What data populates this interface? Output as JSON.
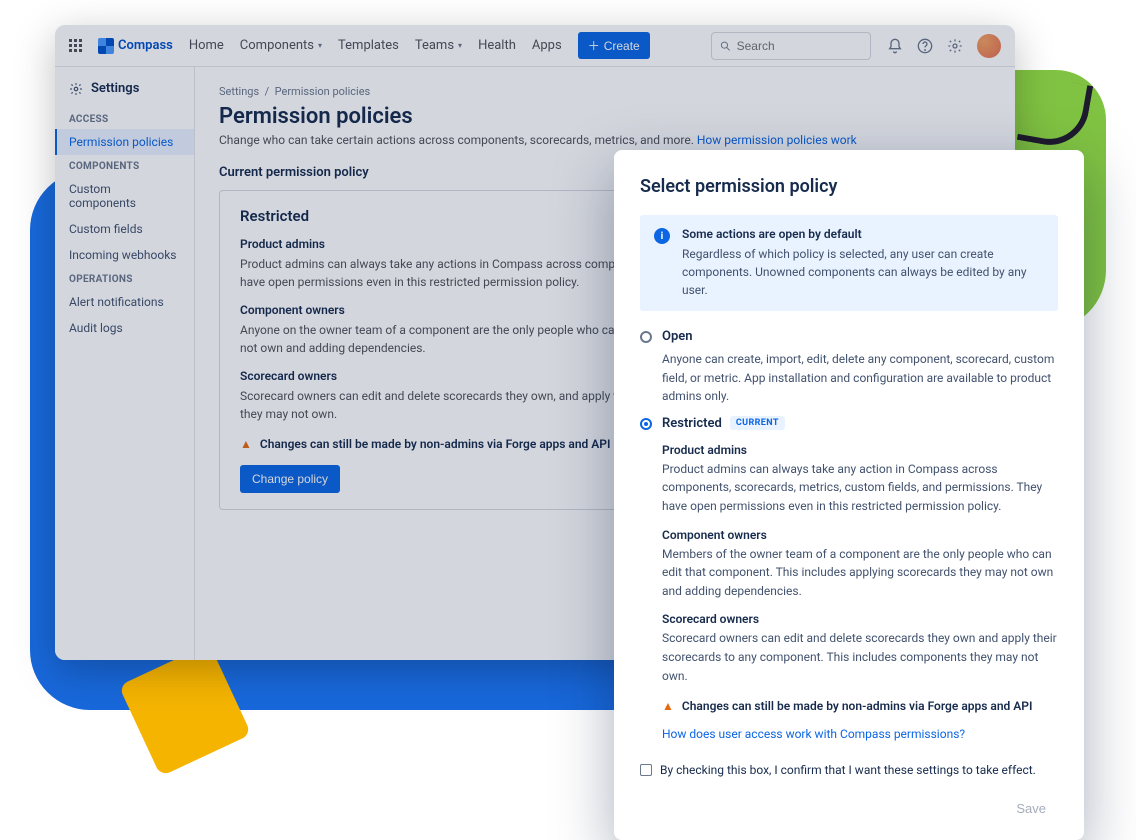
{
  "topbar": {
    "product": "Compass",
    "nav": [
      "Home",
      "Components",
      "Templates",
      "Teams",
      "Health",
      "Apps"
    ],
    "create": "Create",
    "search_placeholder": "Search"
  },
  "sidebar": {
    "title": "Settings",
    "sections": [
      {
        "heading": "ACCESS",
        "items": [
          "Permission policies"
        ]
      },
      {
        "heading": "COMPONENTS",
        "items": [
          "Custom components",
          "Custom fields",
          "Incoming webhooks"
        ]
      },
      {
        "heading": "OPERATIONS",
        "items": [
          "Alert notifications",
          "Audit logs"
        ]
      }
    ]
  },
  "page": {
    "breadcrumb_a": "Settings",
    "breadcrumb_b": "Permission policies",
    "title": "Permission policies",
    "subtitle": "Change who can take certain actions across components, scorecards, metrics, and more. ",
    "subtitle_link": "How permission policies work",
    "section": "Current permission policy"
  },
  "card": {
    "title": "Restricted",
    "blocks": [
      {
        "h": "Product admins",
        "t": "Product admins can always take any actions in Compass across components, scorecards, metrics, custom fields, and permissions. They have open permissions even in this restricted permission policy."
      },
      {
        "h": "Component owners",
        "t": "Anyone on the owner team of a component are the only people who can edit that component. This includes applying scorecards they may not own and adding dependencies."
      },
      {
        "h": "Scorecard owners",
        "t": "Scorecard owners can edit and delete scorecards they own, and apply their scorecards to any component. This includes components they may not own."
      }
    ],
    "warning": "Changes can still be made by non-admins via Forge apps and API",
    "button": "Change policy"
  },
  "dialog": {
    "title": "Select permission policy",
    "info_title": "Some actions are open by default",
    "info_text": "Regardless of which policy is selected, any user can create components. Unowned components can always be edited by any user.",
    "open": {
      "title": "Open",
      "desc": "Anyone can create, import, edit, delete any component, scorecard, custom field, or metric. App installation and configuration are available to product admins only."
    },
    "restricted": {
      "title": "Restricted",
      "badge": "CURRENT",
      "blocks": [
        {
          "h": "Product admins",
          "t": "Product admins can always take any action in Compass across components, scorecards, metrics, custom fields, and permissions. They have open permissions even in this restricted permission policy."
        },
        {
          "h": "Component owners",
          "t": "Members of the owner team of a component are the only people who can edit that component. This includes applying scorecards they may not own and adding dependencies."
        },
        {
          "h": "Scorecard owners",
          "t": "Scorecard owners can edit and delete scorecards they own and apply their scorecards to any component. This includes components they may not own."
        }
      ],
      "warning": "Changes can still be made by non-admins via Forge apps and API",
      "link": "How does user access work with Compass permissions?"
    },
    "confirm": "By checking this box, I confirm that I want these settings to take effect.",
    "save": "Save"
  }
}
